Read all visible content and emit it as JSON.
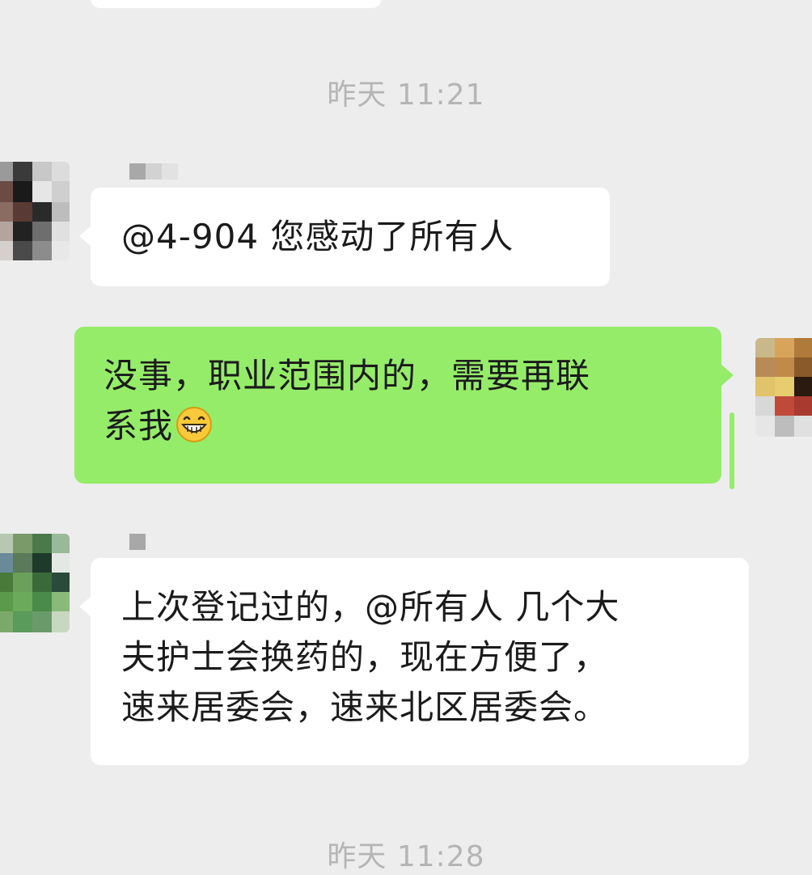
{
  "timestamps": {
    "first": "昨天 11:21",
    "second": "昨天 11:28"
  },
  "messages": [
    {
      "sender": "other",
      "text": "@4-904 您感动了所有人"
    },
    {
      "sender": "self",
      "line1": "没事，职业范围内的，需要再联",
      "line2": "系我",
      "emoji": "grinning-face-emoji"
    },
    {
      "sender": "other",
      "line1": "上次登记过的，@所有人 几个大",
      "line2": "夫护士会换药的，现在方便了，",
      "line3": "速来居委会，速来北区居委会。"
    }
  ],
  "colors": {
    "background": "#ededed",
    "incoming_bubble": "#ffffff",
    "outgoing_bubble": "#95ec69",
    "timestamp_text": "#b5b5b5"
  }
}
